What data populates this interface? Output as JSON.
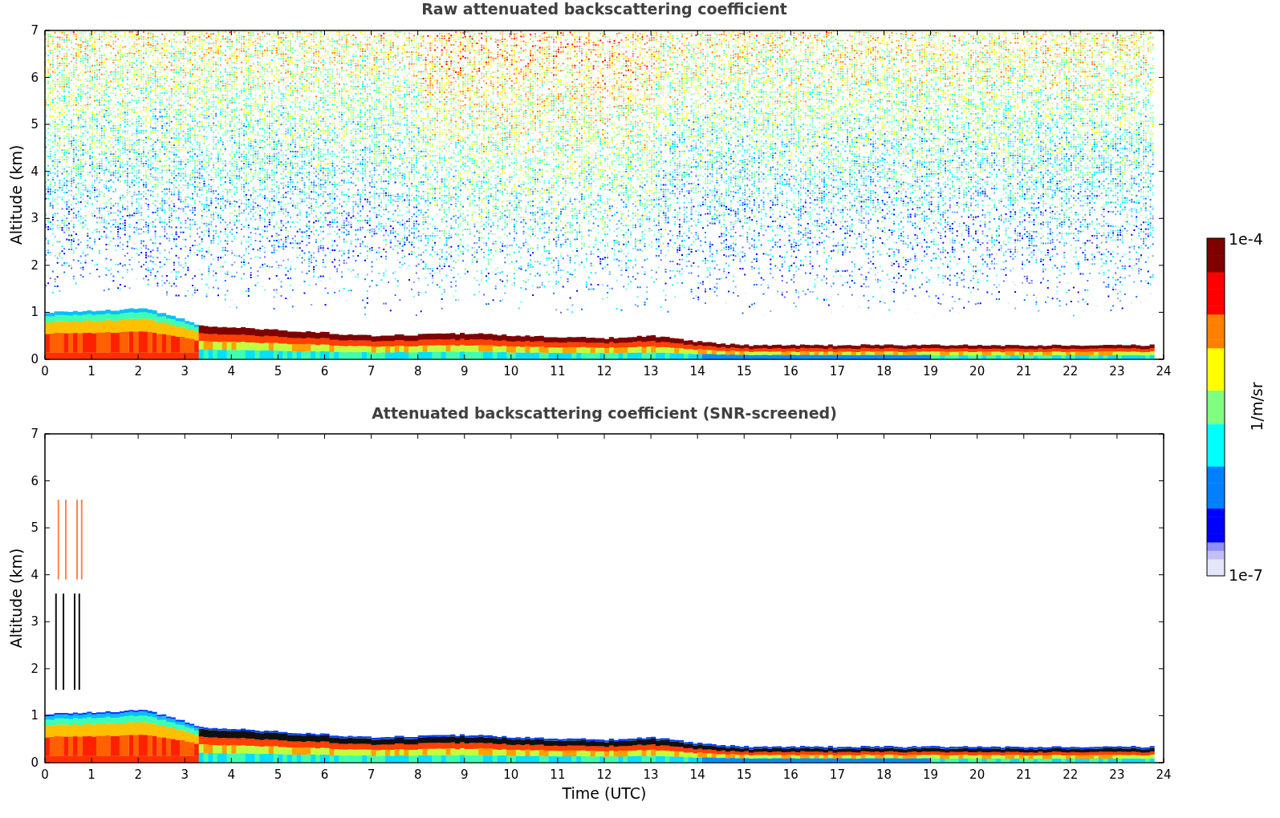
{
  "panels": [
    {
      "kind": "raw",
      "title": "Raw attenuated backscattering coefficient",
      "ylabel": "Altitude (km)",
      "yticks": [
        "7",
        "6",
        "5",
        "4",
        "3",
        "2",
        "1",
        "0"
      ],
      "xticks": [
        "0",
        "1",
        "2",
        "3",
        "4",
        "5",
        "6",
        "7",
        "8",
        "9",
        "10",
        "11",
        "12",
        "13",
        "14",
        "15",
        "16",
        "17",
        "18",
        "19",
        "20",
        "21",
        "22",
        "23",
        "24"
      ]
    },
    {
      "kind": "screened",
      "title": "Attenuated backscattering coefficient (SNR-screened)",
      "ylabel": "Altitude (km)",
      "yticks": [
        "7",
        "6",
        "5",
        "4",
        "3",
        "2",
        "1",
        "0"
      ],
      "xticks": [
        "0",
        "1",
        "2",
        "3",
        "4",
        "5",
        "6",
        "7",
        "8",
        "9",
        "10",
        "11",
        "12",
        "13",
        "14",
        "15",
        "16",
        "17",
        "18",
        "19",
        "20",
        "21",
        "22",
        "23",
        "24"
      ],
      "xlabel": "Time (UTC)"
    }
  ],
  "colorbar": {
    "max_label": "1e-4",
    "min_label": "1e-7",
    "unit_label": "1/m/sr"
  }
}
